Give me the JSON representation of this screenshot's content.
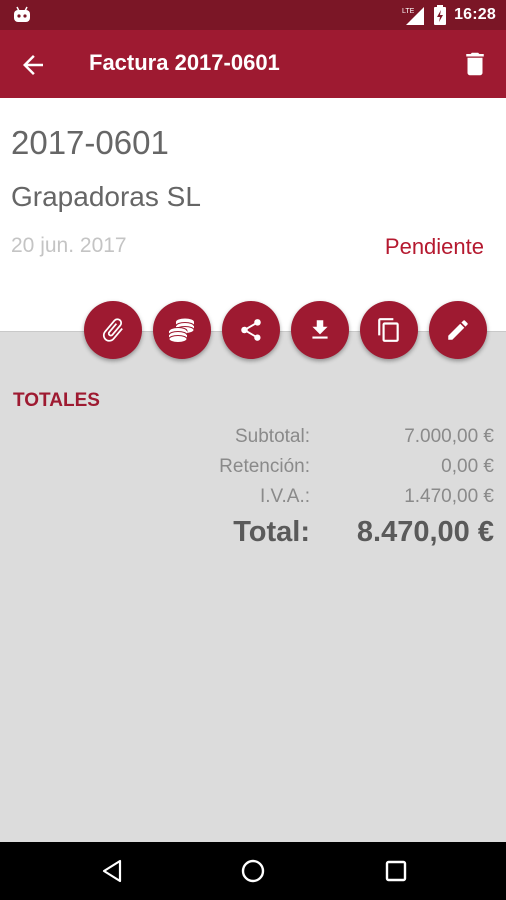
{
  "status_bar": {
    "time": "16:28",
    "network": "LTE"
  },
  "app_bar": {
    "title": "Factura 2017-0601"
  },
  "invoice": {
    "number": "2017-0601",
    "client": "Grapadoras SL",
    "date": "20 jun. 2017",
    "status": "Pendiente"
  },
  "actions": [
    {
      "icon": "attach-icon"
    },
    {
      "icon": "coins-icon"
    },
    {
      "icon": "share-icon"
    },
    {
      "icon": "download-icon"
    },
    {
      "icon": "copy-icon"
    },
    {
      "icon": "edit-icon"
    }
  ],
  "totals": {
    "title": "TOTALES",
    "rows": [
      {
        "label": "Subtotal:",
        "value": "7.000,00 €"
      },
      {
        "label": "Retención:",
        "value": "0,00 €"
      },
      {
        "label": "I.V.A.:",
        "value": "1.470,00 €"
      }
    ],
    "total": {
      "label": "Total:",
      "value": "8.470,00 €"
    }
  },
  "colors": {
    "primary": "#9e1a31",
    "primary_dark": "#7b1626",
    "accent_text": "#b5192f"
  }
}
